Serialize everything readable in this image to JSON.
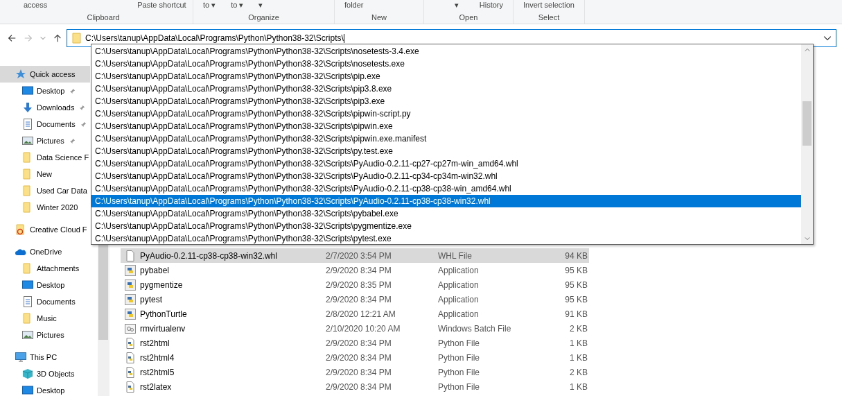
{
  "ribbon": {
    "groups": [
      {
        "label": "Clipboard",
        "items": [
          "access",
          "Paste shortcut"
        ]
      },
      {
        "label": "Organize",
        "items": [
          "to ▾",
          "to ▾",
          "▾"
        ]
      },
      {
        "label": "New",
        "items": [
          "folder"
        ]
      },
      {
        "label": "Open",
        "items": [
          "▾",
          "History"
        ]
      },
      {
        "label": "Select",
        "items": [
          "Invert selection"
        ]
      }
    ]
  },
  "address": {
    "back_disabled": false,
    "forward_disabled": true,
    "value": "C:\\Users\\tanup\\AppData\\Local\\Programs\\Python\\Python38-32\\Scripts\\"
  },
  "suggestions": [
    {
      "text": "C:\\Users\\tanup\\AppData\\Local\\Programs\\Python\\Python38-32\\Scripts\\nosetests-3.4.exe",
      "selected": false
    },
    {
      "text": "C:\\Users\\tanup\\AppData\\Local\\Programs\\Python\\Python38-32\\Scripts\\nosetests.exe",
      "selected": false
    },
    {
      "text": "C:\\Users\\tanup\\AppData\\Local\\Programs\\Python\\Python38-32\\Scripts\\pip.exe",
      "selected": false
    },
    {
      "text": "C:\\Users\\tanup\\AppData\\Local\\Programs\\Python\\Python38-32\\Scripts\\pip3.8.exe",
      "selected": false
    },
    {
      "text": "C:\\Users\\tanup\\AppData\\Local\\Programs\\Python\\Python38-32\\Scripts\\pip3.exe",
      "selected": false
    },
    {
      "text": "C:\\Users\\tanup\\AppData\\Local\\Programs\\Python\\Python38-32\\Scripts\\pipwin-script.py",
      "selected": false
    },
    {
      "text": "C:\\Users\\tanup\\AppData\\Local\\Programs\\Python\\Python38-32\\Scripts\\pipwin.exe",
      "selected": false
    },
    {
      "text": "C:\\Users\\tanup\\AppData\\Local\\Programs\\Python\\Python38-32\\Scripts\\pipwin.exe.manifest",
      "selected": false
    },
    {
      "text": "C:\\Users\\tanup\\AppData\\Local\\Programs\\Python\\Python38-32\\Scripts\\py.test.exe",
      "selected": false
    },
    {
      "text": "C:\\Users\\tanup\\AppData\\Local\\Programs\\Python\\Python38-32\\Scripts\\PyAudio-0.2.11-cp27-cp27m-win_amd64.whl",
      "selected": false
    },
    {
      "text": "C:\\Users\\tanup\\AppData\\Local\\Programs\\Python\\Python38-32\\Scripts\\PyAudio-0.2.11-cp34-cp34m-win32.whl",
      "selected": false
    },
    {
      "text": "C:\\Users\\tanup\\AppData\\Local\\Programs\\Python\\Python38-32\\Scripts\\PyAudio-0.2.11-cp38-cp38-win_amd64.whl",
      "selected": false
    },
    {
      "text": "C:\\Users\\tanup\\AppData\\Local\\Programs\\Python\\Python38-32\\Scripts\\PyAudio-0.2.11-cp38-cp38-win32.whl",
      "selected": true
    },
    {
      "text": "C:\\Users\\tanup\\AppData\\Local\\Programs\\Python\\Python38-32\\Scripts\\pybabel.exe",
      "selected": false
    },
    {
      "text": "C:\\Users\\tanup\\AppData\\Local\\Programs\\Python\\Python38-32\\Scripts\\pygmentize.exe",
      "selected": false
    },
    {
      "text": "C:\\Users\\tanup\\AppData\\Local\\Programs\\Python\\Python38-32\\Scripts\\pytest.exe",
      "selected": false
    }
  ],
  "sidebar": {
    "sections": [
      {
        "label": "Quick access",
        "kind": "star",
        "selected": true,
        "children": [
          {
            "label": "Desktop",
            "kind": "desktop",
            "pinned": true
          },
          {
            "label": "Downloads",
            "kind": "downloads",
            "pinned": true
          },
          {
            "label": "Documents",
            "kind": "documents",
            "pinned": true
          },
          {
            "label": "Pictures",
            "kind": "pictures",
            "pinned": true
          },
          {
            "label": "Data Science F",
            "kind": "folder",
            "pinned": false
          },
          {
            "label": "New",
            "kind": "folder",
            "pinned": false
          },
          {
            "label": "Used Car Data",
            "kind": "folder",
            "pinned": false
          },
          {
            "label": "Winter 2020",
            "kind": "folder",
            "pinned": false
          }
        ]
      },
      {
        "label": "Creative Cloud F",
        "kind": "creative-cloud",
        "selected": false
      },
      {
        "label": "OneDrive",
        "kind": "cloud",
        "selected": false,
        "children": [
          {
            "label": "Attachments",
            "kind": "folder",
            "pinned": false
          },
          {
            "label": "Desktop",
            "kind": "desktop",
            "pinned": false
          },
          {
            "label": "Documents",
            "kind": "documents",
            "pinned": false
          },
          {
            "label": "Music",
            "kind": "folder",
            "pinned": false
          },
          {
            "label": "Pictures",
            "kind": "pictures",
            "pinned": false
          }
        ]
      },
      {
        "label": "This PC",
        "kind": "pc",
        "selected": false,
        "children": [
          {
            "label": "3D Objects",
            "kind": "cube",
            "pinned": false
          },
          {
            "label": "Desktop",
            "kind": "desktop",
            "pinned": false
          }
        ]
      }
    ]
  },
  "files": [
    {
      "name": "PyAudio-0.2.11-cp38-cp38-win32.whl",
      "kind": "whl",
      "date": "2/7/2020 3:54 PM",
      "type": "WHL File",
      "size": "94 KB",
      "selected": true
    },
    {
      "name": "pybabel",
      "kind": "python-app",
      "date": "2/9/2020 8:34 PM",
      "type": "Application",
      "size": "95 KB",
      "selected": false
    },
    {
      "name": "pygmentize",
      "kind": "python-app",
      "date": "2/9/2020 8:35 PM",
      "type": "Application",
      "size": "95 KB",
      "selected": false
    },
    {
      "name": "pytest",
      "kind": "python-app",
      "date": "2/9/2020 8:34 PM",
      "type": "Application",
      "size": "95 KB",
      "selected": false
    },
    {
      "name": "PythonTurtle",
      "kind": "python-app",
      "date": "2/8/2020 12:21 AM",
      "type": "Application",
      "size": "91 KB",
      "selected": false
    },
    {
      "name": "rmvirtualenv",
      "kind": "batch",
      "date": "2/10/2020 10:20 AM",
      "type": "Windows Batch File",
      "size": "2 KB",
      "selected": false
    },
    {
      "name": "rst2html",
      "kind": "python-file",
      "date": "2/9/2020 8:34 PM",
      "type": "Python File",
      "size": "1 KB",
      "selected": false
    },
    {
      "name": "rst2html4",
      "kind": "python-file",
      "date": "2/9/2020 8:34 PM",
      "type": "Python File",
      "size": "1 KB",
      "selected": false
    },
    {
      "name": "rst2html5",
      "kind": "python-file",
      "date": "2/9/2020 8:34 PM",
      "type": "Python File",
      "size": "2 KB",
      "selected": false
    },
    {
      "name": "rst2latex",
      "kind": "python-file",
      "date": "2/9/2020 8:34 PM",
      "type": "Python File",
      "size": "1 KB",
      "selected": false
    }
  ]
}
